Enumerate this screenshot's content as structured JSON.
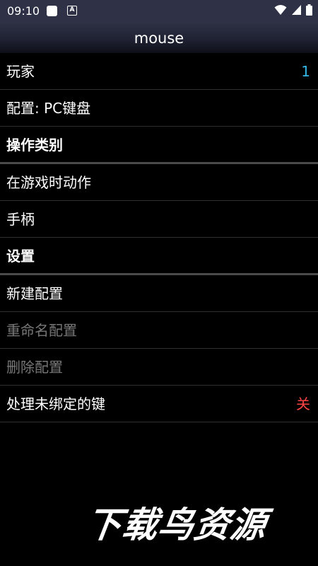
{
  "status_bar": {
    "time": "09:10",
    "notif_a_label": "A",
    "icons": [
      "square-icon",
      "a-notification-icon",
      "wifi-icon",
      "signal-icon",
      "battery-icon"
    ]
  },
  "app_bar": {
    "title": "mouse"
  },
  "rows": [
    {
      "label": "玩家",
      "value": "1"
    },
    {
      "label": "配置: PC键盘"
    },
    {
      "label": "操作类别"
    },
    {
      "label": "在游戏时动作"
    },
    {
      "label": "手柄"
    },
    {
      "label": "设置"
    },
    {
      "label": "新建配置"
    },
    {
      "label": "重命名配置"
    },
    {
      "label": "删除配置"
    },
    {
      "label": "处理未绑定的键",
      "value": "关"
    }
  ],
  "watermark": "下载鸟资源",
  "colors": {
    "status_bar_bg": "#2f3146",
    "value_blue": "#33b5e5",
    "value_red": "#ff4444",
    "disabled_text": "#777777"
  }
}
